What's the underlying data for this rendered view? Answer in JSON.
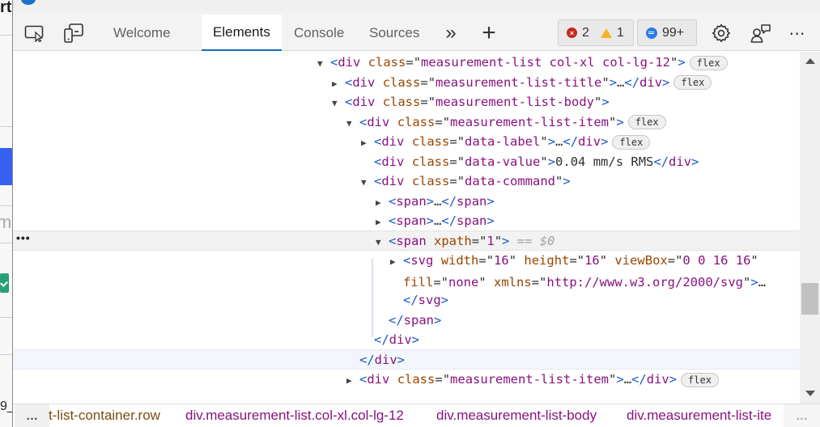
{
  "page_fragment": {
    "heading_fragment": "rt",
    "text_fragment": "m",
    "bottom_fragment": "9_"
  },
  "toolbar": {
    "tabs": [
      {
        "label": "Welcome",
        "active": false
      },
      {
        "label": "Elements",
        "active": true
      },
      {
        "label": "Console",
        "active": false
      },
      {
        "label": "Sources",
        "active": false
      }
    ],
    "more_tabs_glyph": "»",
    "add_tab_glyph": "+",
    "errors_count": "2",
    "warnings_count": "1",
    "messages_count": "99+",
    "more_glyph": "⋯"
  },
  "dom_tree": {
    "rows": [
      {
        "tag": "div",
        "attrs": [
          {
            "name": "class",
            "value": "measurement-list col-xl col-lg-12"
          }
        ],
        "expanded": true,
        "badge": "flex"
      },
      {
        "tag": "div",
        "attrs": [
          {
            "name": "class",
            "value": "measurement-list-title"
          }
        ],
        "collapsed_ellipsis": "…",
        "badge": "flex"
      },
      {
        "tag": "div",
        "attrs": [
          {
            "name": "class",
            "value": "measurement-list-body"
          }
        ],
        "expanded": true
      },
      {
        "tag": "div",
        "attrs": [
          {
            "name": "class",
            "value": "measurement-list-item"
          }
        ],
        "expanded": true,
        "badge": "flex"
      },
      {
        "tag": "div",
        "attrs": [
          {
            "name": "class",
            "value": "data-label"
          }
        ],
        "collapsed_ellipsis": "…",
        "badge": "flex"
      },
      {
        "tag": "div",
        "attrs": [
          {
            "name": "class",
            "value": "data-value"
          }
        ],
        "text": "0.04 mm/s RMS"
      },
      {
        "tag": "div",
        "attrs": [
          {
            "name": "class",
            "value": "data-command"
          }
        ],
        "expanded": true
      },
      {
        "tag": "span",
        "collapsed_ellipsis": "…"
      },
      {
        "tag": "span",
        "collapsed_ellipsis": "…"
      },
      {
        "tag": "span",
        "attrs": [
          {
            "name": "xpath",
            "value": "1"
          }
        ],
        "expanded": true,
        "selected_marker": "== $0"
      },
      {
        "tag": "svg",
        "attrs": [
          {
            "name": "width",
            "value": "16"
          },
          {
            "name": "height",
            "value": "16"
          },
          {
            "name": "viewBox",
            "value": "0 0 16 16"
          },
          {
            "name": "fill",
            "value": "none"
          },
          {
            "name": "xmlns",
            "value": "http://www.w3.org/2000/svg"
          }
        ],
        "collapsed_ellipsis": "…"
      },
      {
        "closing": "svg"
      },
      {
        "closing": "span"
      },
      {
        "closing": "div"
      },
      {
        "closing": "div"
      },
      {
        "tag": "div",
        "attrs": [
          {
            "name": "class",
            "value": "measurement-list-item"
          }
        ],
        "collapsed_ellipsis": "…",
        "badge": "flex"
      }
    ],
    "gutter_dots": "•••"
  },
  "breadcrumbs": {
    "more_left": "…",
    "items": [
      "t-list-container.row",
      "div.measurement-list.col-xl.col-lg-12",
      "div.measurement-list-body",
      "div.measurement-list-ite"
    ],
    "more_right": "…"
  },
  "colors": {
    "accent": "#0f6cbd",
    "error": "#c42b1c",
    "warning": "#f5b22a",
    "info": "#2b7de9",
    "tag": "#881280",
    "attr_name": "#994500",
    "bracket": "#1a58c9"
  }
}
